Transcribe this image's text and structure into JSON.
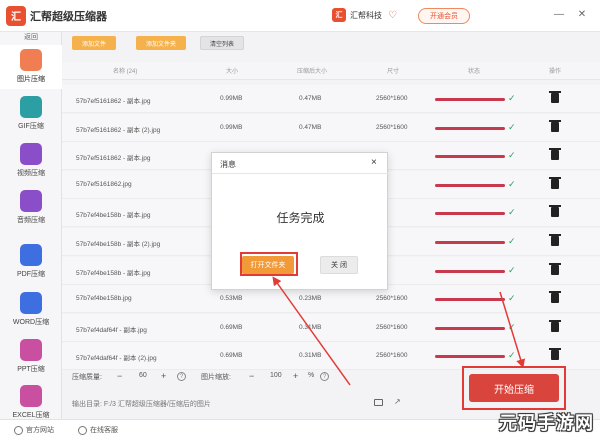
{
  "app": {
    "logo": "汇",
    "title": "汇帮超级压缩器",
    "brand": "汇帮科技",
    "vip": "开通会员"
  },
  "sidebar": {
    "back": "返回",
    "items": [
      {
        "label": "图片压缩",
        "icon": "image-icon",
        "color": "#f07e52",
        "active": true
      },
      {
        "label": "GIF压缩",
        "icon": "gif-icon",
        "color": "#2b9fa4"
      },
      {
        "label": "视频压缩",
        "icon": "video-icon",
        "color": "#8a4fc8"
      },
      {
        "label": "音频压缩",
        "icon": "audio-icon",
        "color": "#8a4fc8"
      },
      {
        "label": "PDF压缩",
        "icon": "pdf-icon",
        "color": "#3d6fe0"
      },
      {
        "label": "WORD压缩",
        "icon": "word-icon",
        "color": "#3d6fe0"
      },
      {
        "label": "PPT压缩",
        "icon": "ppt-icon",
        "color": "#c94fa0"
      },
      {
        "label": "EXCEL压缩",
        "icon": "excel-icon",
        "color": "#c94fa0"
      }
    ]
  },
  "toolbar": {
    "add_file": "添加文件",
    "add_folder": "添加文件夹",
    "clear_list": "清空列表"
  },
  "table": {
    "headers": [
      "名称 (24)",
      "大小",
      "压缩后大小",
      "尺寸",
      "状态",
      "操作"
    ],
    "rows": [
      {
        "name": "57b7ef5161862 - 副本.jpg",
        "size": "0.99MB",
        "after": "0.47MB",
        "dim": "2560*1600"
      },
      {
        "name": "57b7ef5161862 - 副本 (2).jpg",
        "size": "0.99MB",
        "after": "0.47MB",
        "dim": "2560*1600"
      },
      {
        "name": "57b7ef5161862 - 副本.jpg",
        "size": "",
        "after": "",
        "dim": ""
      },
      {
        "name": "57b7ef5161862.jpg",
        "size": "",
        "after": "",
        "dim": ""
      },
      {
        "name": "57b7ef4be158b - 副本.jpg",
        "size": "",
        "after": "",
        "dim": ""
      },
      {
        "name": "57b7ef4be158b - 副本 (2).jpg",
        "size": "",
        "after": "",
        "dim": ""
      },
      {
        "name": "57b7ef4be158b - 副本.jpg",
        "size": "",
        "after": "",
        "dim": ""
      },
      {
        "name": "57b7ef4be158b.jpg",
        "size": "0.53MB",
        "after": "0.23MB",
        "dim": "2560*1600"
      },
      {
        "name": "57b7ef4daf64f - 副本.jpg",
        "size": "0.69MB",
        "after": "0.31MB",
        "dim": "2560*1600"
      },
      {
        "name": "57b7ef4daf64f - 副本 (2).jpg",
        "size": "0.69MB",
        "after": "0.31MB",
        "dim": "2560*1600"
      }
    ]
  },
  "settings": {
    "quality_label": "压缩质量:",
    "quality_minus": "−",
    "quality_value": "60",
    "quality_plus": "+",
    "scale_label": "图片缩放:",
    "scale_minus": "−",
    "scale_value": "100",
    "scale_plus": "+",
    "scale_unit": "%"
  },
  "output": {
    "label": "输出目录: F:/3 汇帮超级压缩器/压缩后的图片"
  },
  "start_button": "开始压缩",
  "footer": {
    "website": "官方网站",
    "support": "在线客服"
  },
  "watermark": "元码手游网",
  "modal": {
    "title": "消息",
    "message": "任务完成",
    "open_folder": "打开文件夹",
    "close": "关 闭"
  }
}
